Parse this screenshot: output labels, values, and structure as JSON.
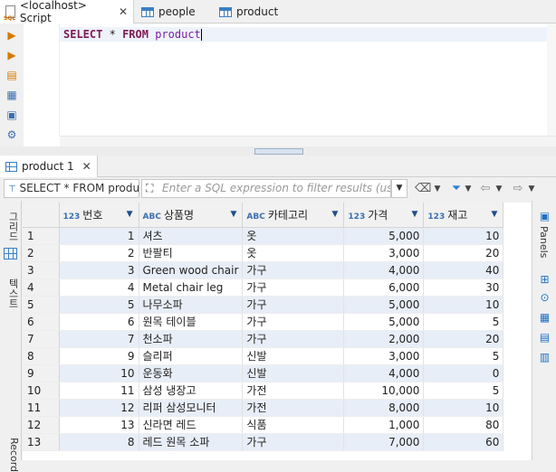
{
  "editor_tabs": [
    {
      "label": "<localhost> Script",
      "active": true
    },
    {
      "label": "people",
      "active": false
    },
    {
      "label": "product",
      "active": false
    }
  ],
  "editor": {
    "sql_keyword1": "SELECT",
    "sql_star": "*",
    "sql_keyword2": "FROM",
    "sql_table": "product"
  },
  "results_tab": {
    "label": "product 1"
  },
  "filter": {
    "query_label": "SELECT * FROM produc",
    "placeholder": "Enter a SQL expression to filter results (use"
  },
  "vertical_tabs": {
    "grid": "그리드",
    "text": "텍스트",
    "record": "Record"
  },
  "right_panel": {
    "label": "Panels"
  },
  "columns": [
    {
      "type": "123",
      "name": "번호"
    },
    {
      "type": "ABC",
      "name": "상품명"
    },
    {
      "type": "ABC",
      "name": "카테고리"
    },
    {
      "type": "123",
      "name": "가격"
    },
    {
      "type": "123",
      "name": "재고"
    }
  ],
  "rows": [
    {
      "rn": "1",
      "id": "1",
      "name": "셔츠",
      "cat": "옷",
      "price": "5,000",
      "stock": "10"
    },
    {
      "rn": "2",
      "id": "2",
      "name": "반팔티",
      "cat": "옷",
      "price": "3,000",
      "stock": "20"
    },
    {
      "rn": "3",
      "id": "3",
      "name": "Green wood chair",
      "cat": "가구",
      "price": "4,000",
      "stock": "40"
    },
    {
      "rn": "4",
      "id": "4",
      "name": "Metal chair leg",
      "cat": "가구",
      "price": "6,000",
      "stock": "30"
    },
    {
      "rn": "5",
      "id": "5",
      "name": "나무소파",
      "cat": "가구",
      "price": "5,000",
      "stock": "10"
    },
    {
      "rn": "6",
      "id": "6",
      "name": "원목 테이블",
      "cat": "가구",
      "price": "5,000",
      "stock": "5"
    },
    {
      "rn": "7",
      "id": "7",
      "name": "천소파",
      "cat": "가구",
      "price": "2,000",
      "stock": "20"
    },
    {
      "rn": "8",
      "id": "9",
      "name": "슬리퍼",
      "cat": "신발",
      "price": "3,000",
      "stock": "5"
    },
    {
      "rn": "9",
      "id": "10",
      "name": "운동화",
      "cat": "신발",
      "price": "4,000",
      "stock": "0"
    },
    {
      "rn": "10",
      "id": "11",
      "name": "삼성 냉장고",
      "cat": "가전",
      "price": "10,000",
      "stock": "5"
    },
    {
      "rn": "11",
      "id": "12",
      "name": "리퍼 삼성모니터",
      "cat": "가전",
      "price": "8,000",
      "stock": "10"
    },
    {
      "rn": "12",
      "id": "13",
      "name": "신라면 레드",
      "cat": "식품",
      "price": "1,000",
      "stock": "80"
    },
    {
      "rn": "13",
      "id": "8",
      "name": "레드 원목 소파",
      "cat": "가구",
      "price": "7,000",
      "stock": "60"
    }
  ]
}
